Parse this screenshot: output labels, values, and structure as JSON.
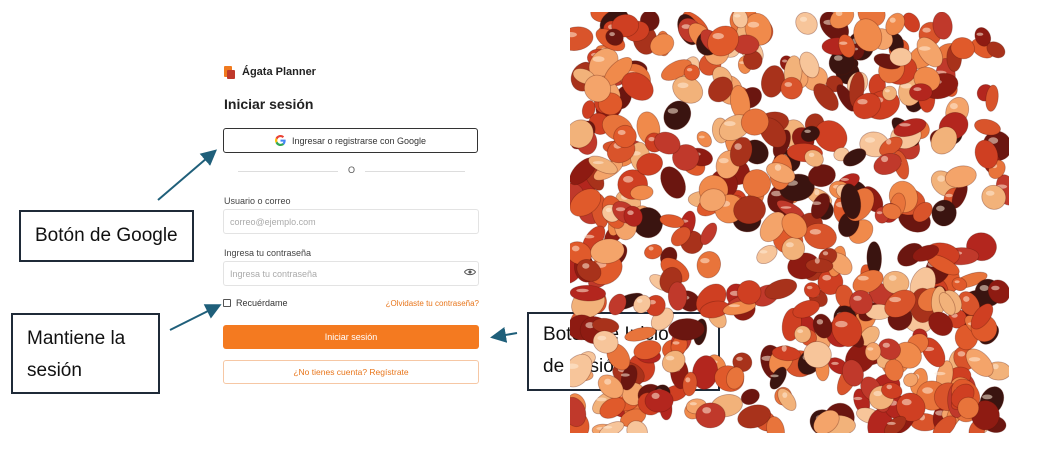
{
  "brand": {
    "name": "Ágata Planner",
    "icon": "agata-logo-icon",
    "colors": {
      "orange": "#f07a1f",
      "red": "#c0392b"
    }
  },
  "login": {
    "title": "Iniciar sesión",
    "google_button": "Ingresar o registrarse con Google",
    "divider": "O",
    "user_label": "Usuario o correo",
    "user_placeholder": "correo@ejemplo.com",
    "password_label": "Ingresa tu contraseña",
    "password_placeholder": "Ingresa tu contraseña",
    "remember": "Recuérdame",
    "forgot": "¿Olvidaste tu contraseña?",
    "submit": "Iniciar sesión",
    "register": "¿No tienes cuenta? Regístrate"
  },
  "annotations": {
    "google": "Botón de Google",
    "remember_line1": "Mantiene la",
    "remember_line2": "sesión",
    "login_line1": "Botón de Inicio",
    "login_line2": "de sesión"
  },
  "colors": {
    "accent": "#f47a20",
    "link": "#e8761c",
    "callout_border": "#1f2a38",
    "arrow": "#1f5f7a"
  }
}
